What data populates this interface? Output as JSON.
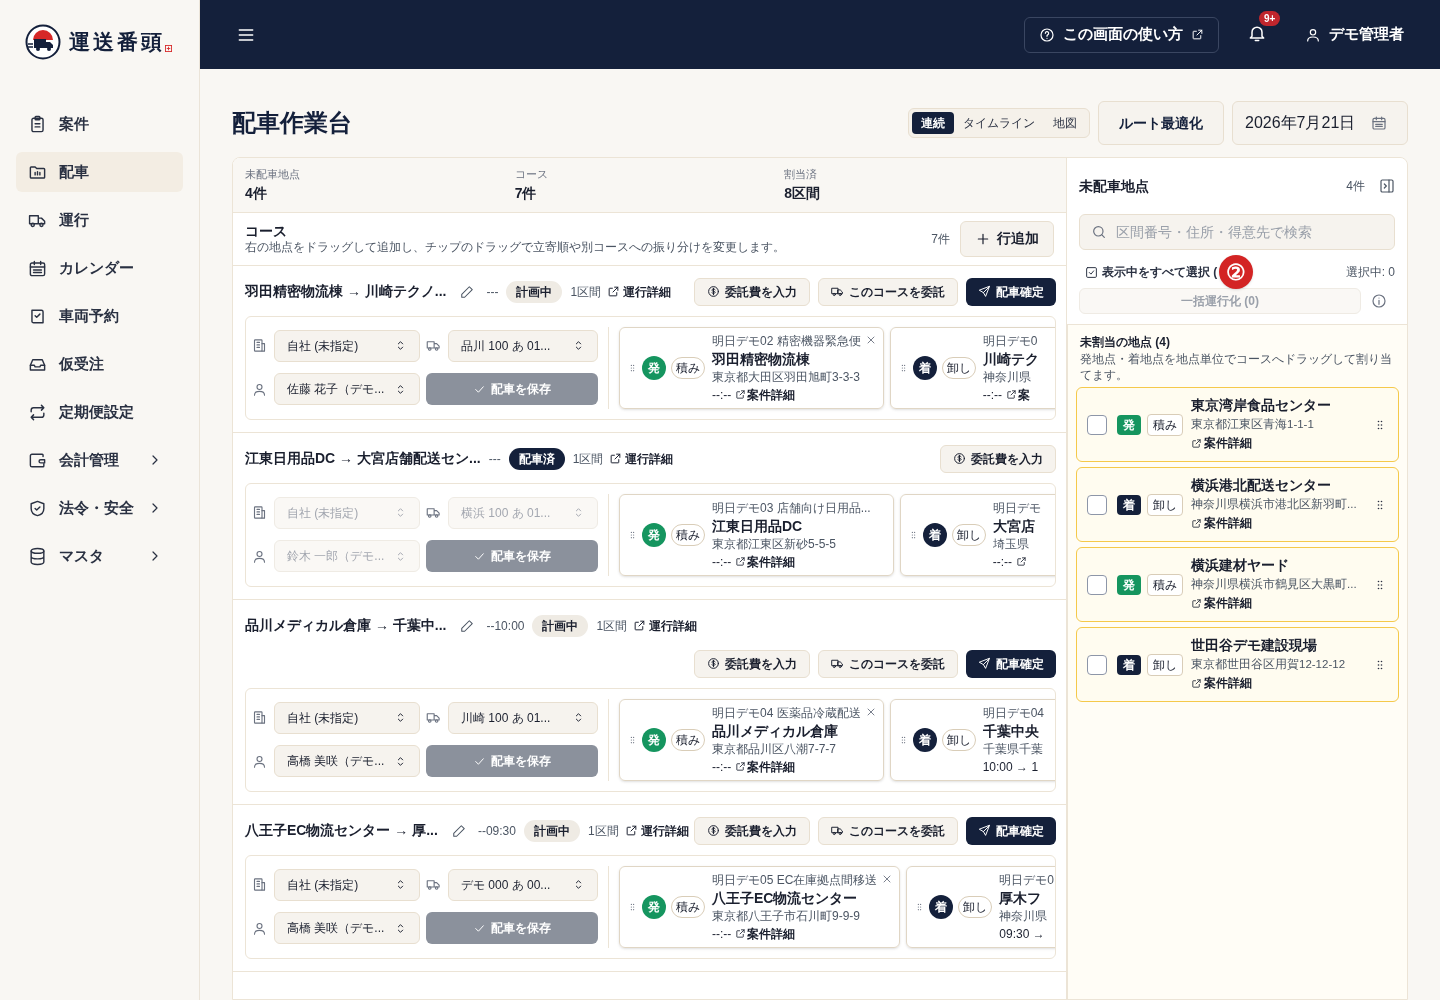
{
  "sidebar": {
    "brand": "運送番頭",
    "items": [
      {
        "label": "案件",
        "selected": false,
        "has_children": false
      },
      {
        "label": "配車",
        "selected": true,
        "has_children": false
      },
      {
        "label": "運行",
        "selected": false,
        "has_children": false
      },
      {
        "label": "カレンダー",
        "selected": false,
        "has_children": false
      },
      {
        "label": "車両予約",
        "selected": false,
        "has_children": false
      },
      {
        "label": "仮受注",
        "selected": false,
        "has_children": false
      },
      {
        "label": "定期便設定",
        "selected": false,
        "has_children": false
      },
      {
        "label": "会計管理",
        "selected": false,
        "has_children": true
      },
      {
        "label": "法令・安全",
        "selected": false,
        "has_children": true
      },
      {
        "label": "マスタ",
        "selected": false,
        "has_children": true
      }
    ]
  },
  "header": {
    "help": "この画面の使い方",
    "notifications": "9+",
    "user": "デモ管理者"
  },
  "page": {
    "title": "配車作業台",
    "view_tabs": [
      {
        "label": "連続",
        "selected": true
      },
      {
        "label": "タイムライン",
        "selected": false
      },
      {
        "label": "地図",
        "selected": false
      }
    ],
    "optimize": "ルート最適化",
    "date": "2026年7月21日"
  },
  "stats": [
    {
      "label": "未配車地点",
      "value": "4件"
    },
    {
      "label": "コース",
      "value": "7件"
    },
    {
      "label": "割当済",
      "value": "8区間"
    }
  ],
  "courses_header": {
    "title": "コース",
    "description": "右の地点をドラッグして追加し、チップのドラッグで立寄順や別コースへの振り分けを変更します。",
    "count": "7件",
    "add": "行追加"
  },
  "courses": [
    {
      "title": "羽田精密物流棟 → 川崎テクノ...",
      "editable": true,
      "time": "---",
      "status": {
        "kind": "planned",
        "label": "計画中"
      },
      "segments": "1区間",
      "detail": "運行詳細",
      "disabled": false,
      "actions": [
        {
          "kind": "fee",
          "label": "委託費を入力"
        },
        {
          "kind": "delegate",
          "label": "このコースを委託"
        },
        {
          "kind": "confirm",
          "label": "配車確定"
        }
      ],
      "company": "自社 (未指定)",
      "vehicle": "品川 100 あ 01...",
      "driver": "佐藤 花子（デモ...",
      "save": "配車を保存",
      "stops": [
        {
          "order": "明日デモ02 精密機器緊急便",
          "removable": true,
          "kind": "origin",
          "badge": "発",
          "action": "積み",
          "name": "羽田精密物流棟",
          "address": "東京都大田区羽田旭町3-3-3",
          "time": "--:--",
          "has_link": true,
          "link": "案件詳細"
        },
        {
          "order": "明日デモ0",
          "removable": false,
          "kind": "destination",
          "badge": "着",
          "action": "卸し",
          "name": "川崎テク",
          "address": "神奈川県",
          "time": "--:--",
          "has_link": true,
          "link": "案"
        }
      ]
    },
    {
      "title": "江東日用品DC → 大宮店舗配送セン...",
      "editable": false,
      "time": "---",
      "status": {
        "kind": "confirmed",
        "label": "配車済"
      },
      "segments": "1区間",
      "detail": "運行詳細",
      "disabled": true,
      "actions": [
        {
          "kind": "fee",
          "label": "委託費を入力"
        }
      ],
      "company": "自社 (未指定)",
      "vehicle": "横浜 100 あ 01...",
      "driver": "鈴木 一郎（デモ...",
      "save": "配車を保存",
      "stops": [
        {
          "order": "明日デモ03 店舗向け日用品...",
          "removable": false,
          "kind": "origin",
          "badge": "発",
          "action": "積み",
          "name": "江東日用品DC",
          "address": "東京都江東区新砂5-5-5",
          "time": "--:--",
          "has_link": true,
          "link": "案件詳細"
        },
        {
          "order": "明日デモ",
          "removable": false,
          "kind": "destination",
          "badge": "着",
          "action": "卸し",
          "name": "大宮店",
          "address": "埼玉県",
          "time": "--:--",
          "has_link": true
        }
      ]
    },
    {
      "title": "品川メディカル倉庫 → 千葉中...",
      "editable": true,
      "time": "--10:00",
      "status": {
        "kind": "planned",
        "label": "計画中"
      },
      "segments": "1区間",
      "detail": "運行詳細",
      "disabled": false,
      "actions": [
        {
          "kind": "fee",
          "label": "委託費を入力"
        },
        {
          "kind": "delegate",
          "label": "このコースを委託"
        },
        {
          "kind": "confirm",
          "label": "配車確定"
        }
      ],
      "company": "自社 (未指定)",
      "vehicle": "川崎 100 あ 01...",
      "driver": "高橋 美咲（デモ...",
      "save": "配車を保存",
      "stops": [
        {
          "order": "明日デモ04 医薬品冷蔵配送",
          "removable": true,
          "kind": "origin",
          "badge": "発",
          "action": "積み",
          "name": "品川メディカル倉庫",
          "address": "東京都品川区八潮7-7-7",
          "time": "--:--",
          "has_link": true,
          "link": "案件詳細"
        },
        {
          "order": "明日デモ04",
          "removable": false,
          "kind": "destination",
          "badge": "着",
          "action": "卸し",
          "name": "千葉中央",
          "address": "千葉県千葉",
          "time": "10:00 → 1",
          "has_link": false
        }
      ]
    },
    {
      "title": "八王子EC物流センター → 厚...",
      "editable": true,
      "time": "--09:30",
      "status": {
        "kind": "planned",
        "label": "計画中"
      },
      "segments": "1区間",
      "detail": "運行詳細",
      "disabled": false,
      "actions": [
        {
          "kind": "fee",
          "label": "委託費を入力"
        },
        {
          "kind": "delegate",
          "label": "このコースを委託"
        },
        {
          "kind": "confirm",
          "label": "配車確定"
        }
      ],
      "company": "自社 (未指定)",
      "vehicle": "デモ 000 あ 00...",
      "driver": "高橋 美咲（デモ...",
      "save": "配車を保存",
      "stops": [
        {
          "order": "明日デモ05 EC在庫拠点間移送",
          "removable": true,
          "kind": "origin",
          "badge": "発",
          "action": "積み",
          "name": "八王子EC物流センター",
          "address": "東京都八王子市石川町9-9-9",
          "time": "--:--",
          "has_link": true,
          "link": "案件詳細"
        },
        {
          "order": "明日デモ0",
          "removable": false,
          "kind": "destination",
          "badge": "着",
          "action": "卸し",
          "name": "厚木フ",
          "address": "神奈川県",
          "time": "09:30 →",
          "has_link": false
        }
      ]
    }
  ],
  "unassigned_panel": {
    "title": "未配車地点",
    "count": "4件",
    "search_placeholder": "区間番号・住所・得意先で検索",
    "select_all": "表示中をすべて選択 (",
    "marker": "②",
    "selected_count": "選択中: 0",
    "bulk": "一括運行化 (0)",
    "section_title": "未割当の地点 (4)",
    "section_description": "発地点・着地点を地点単位でコースへドラッグして割り当てます。",
    "items": [
      {
        "checked": false,
        "kind": "origin",
        "badge": "発",
        "action": "積み",
        "name": "東京湾岸食品センター",
        "address": "東京都江東区青海1-1-1",
        "link": "案件詳細"
      },
      {
        "checked": false,
        "kind": "destination",
        "badge": "着",
        "action": "卸し",
        "name": "横浜港北配送センター",
        "address": "神奈川県横浜市港北区新羽町...",
        "link": "案件詳細"
      },
      {
        "checked": false,
        "kind": "origin",
        "badge": "発",
        "action": "積み",
        "name": "横浜建材ヤード",
        "address": "神奈川県横浜市鶴見区大黒町...",
        "link": "案件詳細"
      },
      {
        "checked": false,
        "kind": "destination",
        "badge": "着",
        "action": "卸し",
        "name": "世田谷デモ建設現場",
        "address": "東京都世田谷区用賀12-12-12",
        "link": "案件詳細"
      }
    ]
  }
}
